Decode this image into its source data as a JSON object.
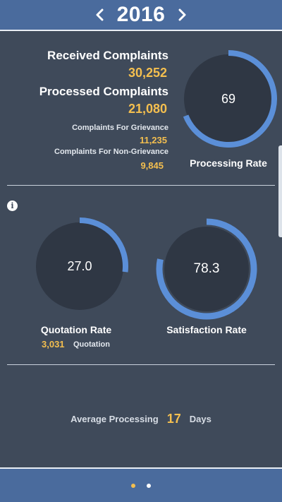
{
  "header": {
    "year": "2016",
    "prev_icon": "chevron-left-icon",
    "next_icon": "chevron-right-icon"
  },
  "summary": {
    "received_label": "Received Complaints",
    "received_value": "30,252",
    "processed_label": "Processed Complaints",
    "processed_value": "21,080",
    "grievance_label": "Complaints For Grievance",
    "grievance_value": "11,235",
    "non_grievance_label": "Complaints For Non-Grievance",
    "non_grievance_value": "9,845"
  },
  "processing_gauge": {
    "value": "69",
    "label": "Processing Rate",
    "percent": 69
  },
  "quotation_gauge": {
    "value": "27.0",
    "label": "Quotation Rate",
    "percent": 27.0,
    "count": "3,031",
    "count_label": "Quotation"
  },
  "satisfaction_gauge": {
    "value": "78.3",
    "label": "Satisfaction Rate",
    "percent": 78.3
  },
  "average": {
    "label": "Average Processing",
    "value": "17",
    "unit": "Days"
  },
  "pager": {
    "pages": 2,
    "active": 1
  },
  "colors": {
    "background": "#3f4a5a",
    "bar": "#4a6b9d",
    "accent": "#f4bf4f",
    "gauge_arc": "#5b8fd8",
    "gauge_fill": "#2f3744"
  }
}
